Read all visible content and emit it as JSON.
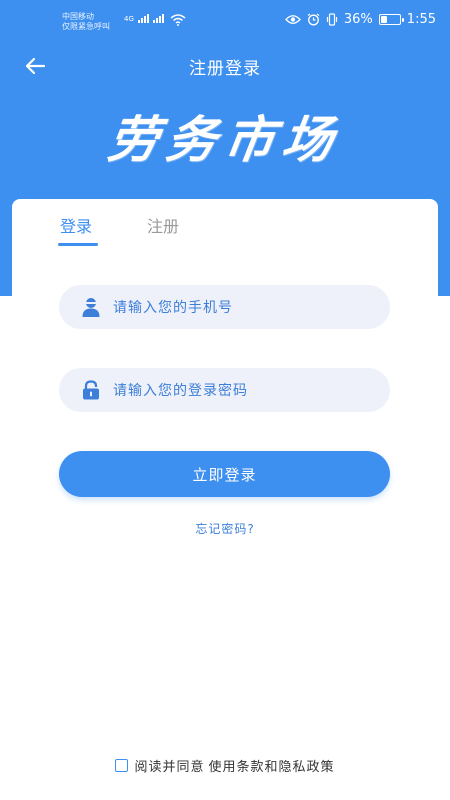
{
  "status_bar": {
    "carrier_line1": "中国移动",
    "carrier_line2": "仅限紧急呼叫",
    "net_label": "4G",
    "battery_percent": "36%",
    "battery_level": 0.36,
    "time": "1:55"
  },
  "nav": {
    "title": "注册登录",
    "back_icon": "arrow-left-icon"
  },
  "brand": {
    "logo_text": "劳务市场"
  },
  "tabs": [
    {
      "label": "登录",
      "active": true
    },
    {
      "label": "注册",
      "active": false
    }
  ],
  "form": {
    "phone_placeholder": "请输入您的手机号",
    "phone_icon": "user-icon",
    "password_placeholder": "请输入您的登录密码",
    "password_icon": "lock-icon",
    "login_label": "立即登录",
    "forgot_label": "忘记密码?"
  },
  "agreement": {
    "checked": false,
    "prefix": "阅读并同意",
    "link": "使用条款和隐私政策"
  },
  "colors": {
    "primary": "#3d8ff0",
    "field_bg": "#eef0fa",
    "placeholder": "#3d7fd8"
  }
}
